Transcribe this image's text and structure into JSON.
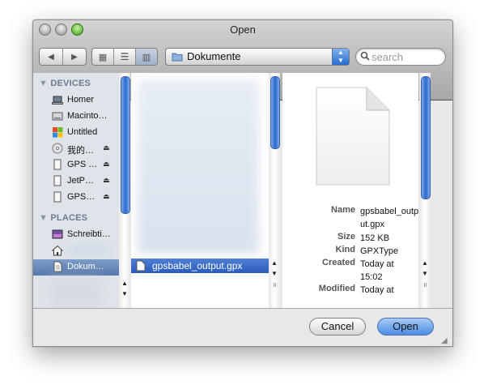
{
  "window": {
    "title": "Open"
  },
  "toolbar": {
    "back_icon": "triangle-left",
    "forward_icon": "triangle-right",
    "view_icons": [
      "icon-view",
      "list-view",
      "column-view"
    ],
    "location": "Dokumente",
    "search_placeholder": "search"
  },
  "sidebar": {
    "devices_header": "DEVICES",
    "places_header": "PLACES",
    "devices": [
      {
        "label": "Homer",
        "icon": "laptop-icon",
        "eject": false
      },
      {
        "label": "Macinto…",
        "icon": "harddisk-icon",
        "eject": false
      },
      {
        "label": "Untitled",
        "icon": "windows-drive-icon",
        "eject": false
      },
      {
        "label": "我的…",
        "icon": "disc-icon",
        "eject": true
      },
      {
        "label": "GPS …",
        "icon": "drive-icon",
        "eject": true
      },
      {
        "label": "JetP…",
        "icon": "drive-icon",
        "eject": true
      },
      {
        "label": "GPS…",
        "icon": "drive-icon",
        "eject": true
      }
    ],
    "places": [
      {
        "label": "Schreibti…",
        "icon": "desktop-icon"
      },
      {
        "label": "",
        "icon": "home-icon"
      },
      {
        "label": "Dokum…",
        "icon": "documents-icon",
        "selected": true
      }
    ],
    "eject_glyph": "⏏"
  },
  "browser": {
    "selected_file": "gpsbabel_output.gpx"
  },
  "preview": {
    "rows": [
      {
        "key": "Name",
        "value": "gpsbabel_outp ut.gpx"
      },
      {
        "key": "Size",
        "value": "152 KB"
      },
      {
        "key": "Kind",
        "value": "GPXType"
      },
      {
        "key": "Created",
        "value": "Today at 15:02"
      },
      {
        "key": "Modified",
        "value": "Today at"
      }
    ]
  },
  "footer": {
    "cancel_label": "Cancel",
    "open_label": "Open"
  }
}
